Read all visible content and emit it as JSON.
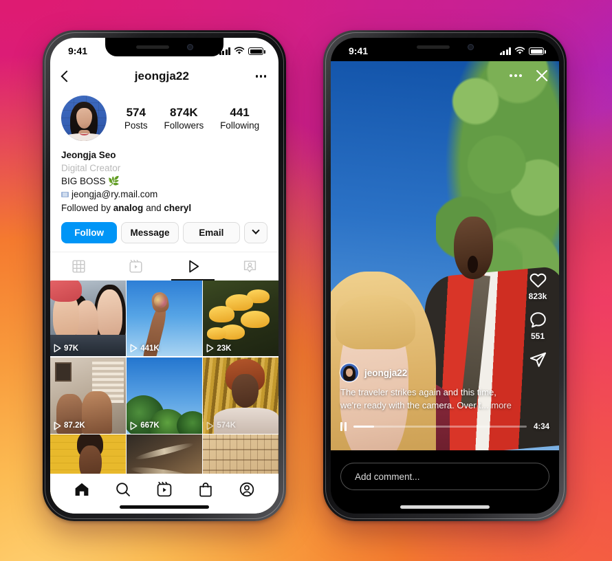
{
  "background": {
    "colors": [
      "#d81e7e",
      "#a926bc",
      "#f2663c",
      "#ffd173"
    ]
  },
  "left_phone": {
    "status_bar": {
      "time": "9:41",
      "signal_icon": "cellular-bars-icon",
      "wifi_icon": "wifi-icon",
      "battery_icon": "battery-icon"
    },
    "header": {
      "back_icon": "back-chevron-icon",
      "title": "jeongja22",
      "more_icon": "more-options-icon"
    },
    "avatar_name": "profile-avatar",
    "stats": [
      {
        "num": "574",
        "label": "Posts"
      },
      {
        "num": "874K",
        "label": "Followers"
      },
      {
        "num": "441",
        "label": "Following"
      }
    ],
    "bio": {
      "display_name": "Jeongja Seo",
      "category": "Digital Creator",
      "line1": "BIG BOSS 🌿",
      "email": "jeongja@ry.mail.com",
      "followed_prefix": "Followed by ",
      "followed_a": "analog",
      "followed_mid": " and ",
      "followed_b": "cheryl"
    },
    "actions": {
      "follow": "Follow",
      "message": "Message",
      "email": "Email",
      "caret_icon": "chevron-down-icon"
    },
    "tabs": [
      {
        "icon": "grid-icon",
        "active": false
      },
      {
        "icon": "reels-icon",
        "active": false
      },
      {
        "icon": "video-play-icon",
        "active": true
      },
      {
        "icon": "tagged-person-icon",
        "active": false
      }
    ],
    "grid": [
      {
        "views": "97K",
        "alt": "three-friends-selfie"
      },
      {
        "views": "441K",
        "alt": "hand-against-blue-sky"
      },
      {
        "views": "23K",
        "alt": "yellow-mushrooms"
      },
      {
        "views": "87.2K",
        "alt": "couple-indoors"
      },
      {
        "views": "667K",
        "alt": "trees-and-sky"
      },
      {
        "views": "574K",
        "alt": "portrait-gold-curtain"
      },
      {
        "views": "",
        "alt": "yellow-brick-portrait"
      },
      {
        "views": "",
        "alt": "aerial-terrain"
      },
      {
        "views": "",
        "alt": "hieroglyph-wall"
      }
    ],
    "bottom_nav": [
      {
        "icon": "home-icon",
        "active": true
      },
      {
        "icon": "search-icon",
        "active": false
      },
      {
        "icon": "reels-icon",
        "active": false
      },
      {
        "icon": "shop-bag-icon",
        "active": false
      },
      {
        "icon": "profile-circle-icon",
        "active": false
      }
    ]
  },
  "right_phone": {
    "status_bar": {
      "time": "9:41",
      "signal_icon": "cellular-bars-icon",
      "wifi_icon": "wifi-icon",
      "battery_icon": "battery-icon"
    },
    "reel_top": {
      "more_icon": "more-options-icon",
      "close_icon": "close-x-icon"
    },
    "rail": {
      "like_icon": "heart-icon",
      "like_count": "823k",
      "comment_icon": "comment-bubble-icon",
      "comment_count": "551",
      "share_icon": "share-paper-plane-icon"
    },
    "caption": {
      "username": "jeongja22",
      "line1": "The traveler strikes again and this time,",
      "line2": "we're ready with the camera. Over t...",
      "more": "more"
    },
    "player": {
      "pause_icon": "pause-icon",
      "progress_percent": 12,
      "duration": "4:34"
    },
    "comment_bar": {
      "placeholder": "Add comment..."
    }
  },
  "colors": {
    "instagram_blue": "#0095F6",
    "muted_gray": "#b9b9b9"
  }
}
